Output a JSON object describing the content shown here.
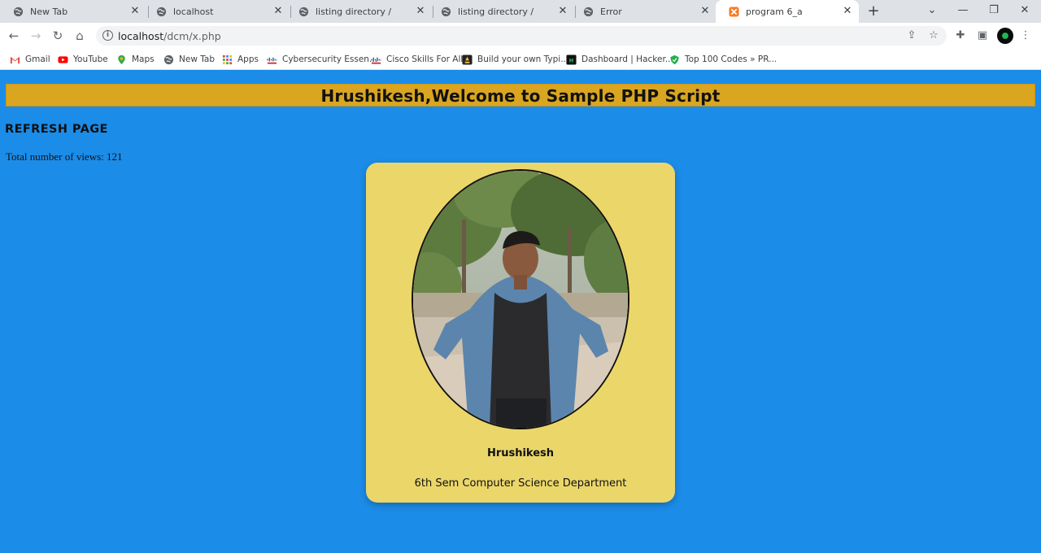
{
  "browser": {
    "tabs": [
      {
        "title": "New Tab",
        "icon": "globe-icon"
      },
      {
        "title": "localhost",
        "icon": "globe-icon"
      },
      {
        "title": "listing directory /",
        "icon": "globe-icon"
      },
      {
        "title": "listing directory /",
        "icon": "globe-icon"
      },
      {
        "title": "Error",
        "icon": "globe-icon"
      },
      {
        "title": "program 6_a",
        "icon": "xampp-icon"
      }
    ],
    "active_tab_index": 5,
    "address": {
      "host": "localhost",
      "path": "/dcm/x.php"
    },
    "bookmarks": [
      {
        "label": "Gmail",
        "icon": "gmail-icon"
      },
      {
        "label": "YouTube",
        "icon": "youtube-icon"
      },
      {
        "label": "Maps",
        "icon": "maps-icon"
      },
      {
        "label": "New Tab",
        "icon": "globe-icon"
      },
      {
        "label": "Apps",
        "icon": "apps-grid-icon"
      },
      {
        "label": "Cybersecurity Essen...",
        "icon": "cisco-icon"
      },
      {
        "label": "Cisco Skills For All",
        "icon": "cisco-icon"
      },
      {
        "label": "Build your own Typi...",
        "icon": "typing-icon"
      },
      {
        "label": "Dashboard | Hacker...",
        "icon": "hackerrank-icon"
      },
      {
        "label": "Top 100 Codes » PR...",
        "icon": "shield-icon"
      }
    ]
  },
  "page": {
    "banner_title": "Hrushikesh,Welcome to Sample PHP Script",
    "refresh_label": "REFRESH PAGE",
    "views_text": "Total number of views: 121",
    "card": {
      "name": "Hrushikesh",
      "department": "6th Sem Computer Science Department"
    }
  },
  "colors": {
    "page_background": "#1b8ce8",
    "banner_background": "#daa520",
    "card_background": "#ebd66a"
  }
}
